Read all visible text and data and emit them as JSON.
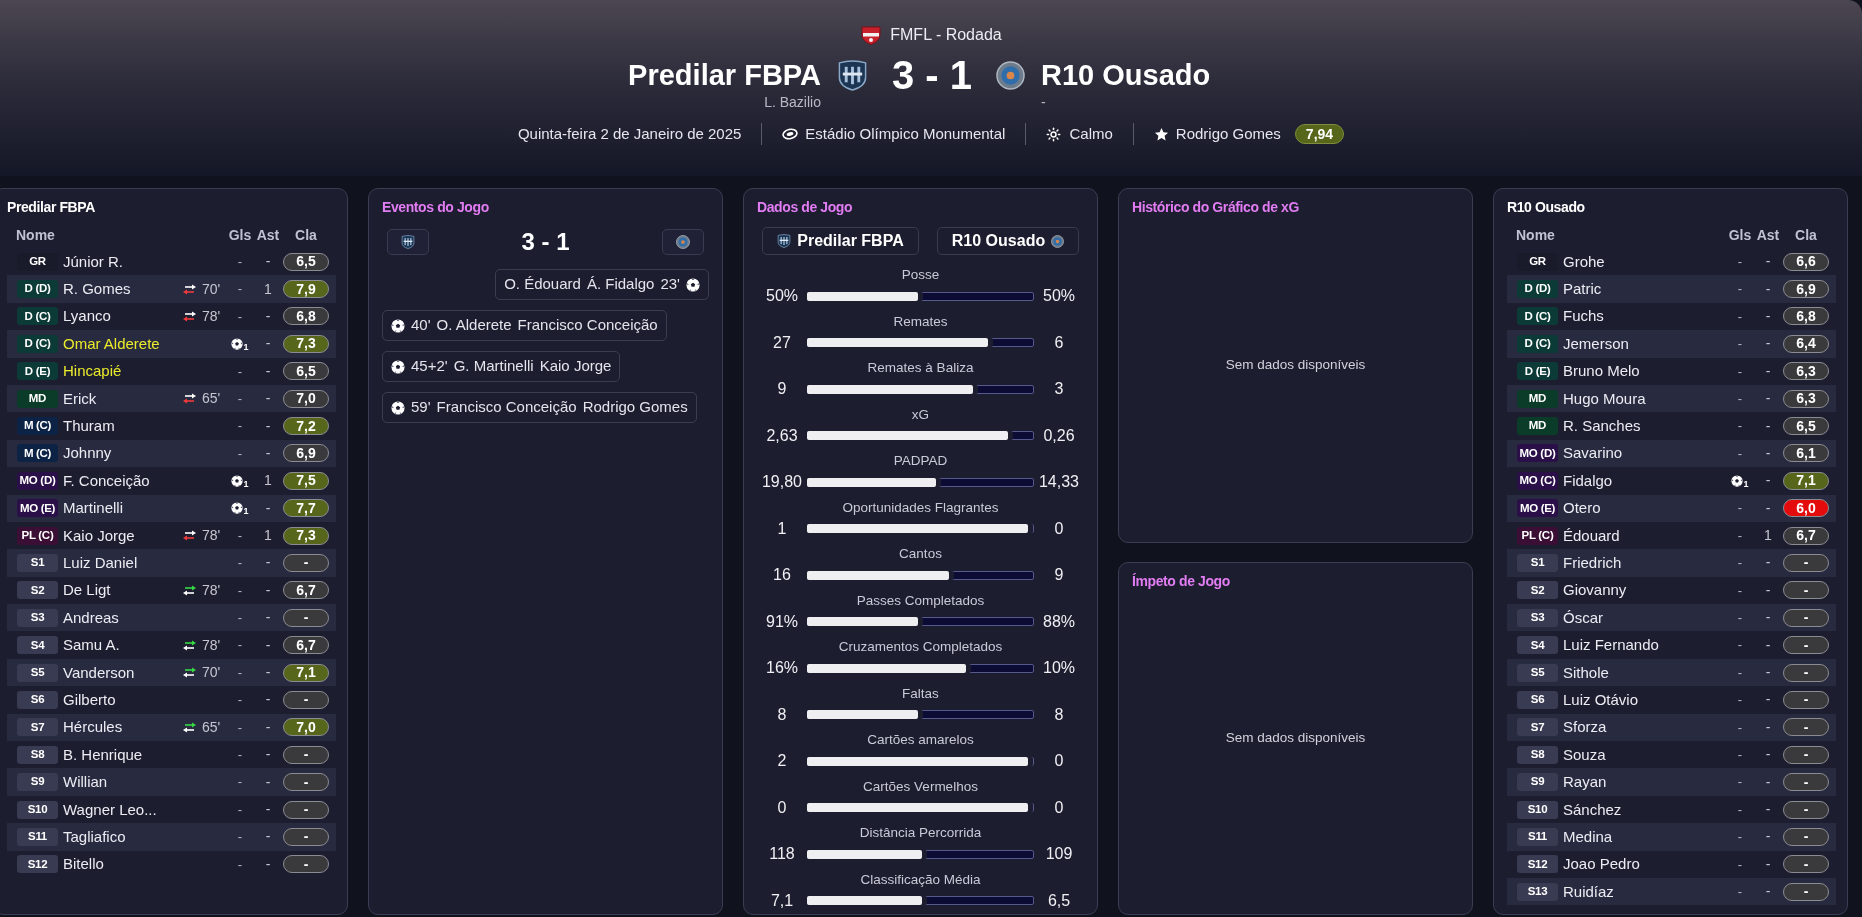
{
  "header": {
    "competition": "FMFL - Rodada",
    "home_team": "Predilar FBPA",
    "home_manager": "L. Bazilio",
    "score": "3 - 1",
    "away_team": "R10 Ousado",
    "away_manager": "-",
    "date": "Quinta-feira 2 de Janeiro de 2025",
    "stadium": "Estádio Olímpico Monumental",
    "weather": "Calmo",
    "player_of_match": "Rodrigo Gomes",
    "player_of_match_rating": "7,94"
  },
  "home_lineup": {
    "title": "Predilar FBPA",
    "columns": [
      "Nome",
      "Gls",
      "Ast",
      "Cla"
    ],
    "players": [
      {
        "position": {
          "text": "GR",
          "color": "#1a1b2a"
        },
        "name": "Júnior R.",
        "highlighted": false,
        "goals": "-",
        "scored": false,
        "assists": "-",
        "rating": {
          "text": "6,5",
          "color": "#3a3a3c"
        }
      },
      {
        "position": {
          "text": "D (D)",
          "color": "#0c3b37"
        },
        "name": "R. Gomes",
        "highlighted": false,
        "substitution": {
          "kind": "off",
          "minute": "70'"
        },
        "goals": "-",
        "scored": false,
        "assists": "1",
        "rating": {
          "text": "7,9",
          "color": "#56671b"
        }
      },
      {
        "position": {
          "text": "D (C)",
          "color": "#0c3b37"
        },
        "name": "Lyanco",
        "highlighted": false,
        "substitution": {
          "kind": "off",
          "minute": "78'"
        },
        "goals": "-",
        "scored": false,
        "assists": "-",
        "rating": {
          "text": "6,8",
          "color": "#3a3a3c"
        }
      },
      {
        "position": {
          "text": "D (C)",
          "color": "#0c3b37"
        },
        "name": "Omar Alderete",
        "highlighted": true,
        "goals": "1",
        "scored": true,
        "assists": "-",
        "rating": {
          "text": "7,3",
          "color": "#56671b"
        }
      },
      {
        "position": {
          "text": "D (E)",
          "color": "#0c3b37"
        },
        "name": "Hincapié",
        "highlighted": true,
        "goals": "-",
        "scored": false,
        "assists": "-",
        "rating": {
          "text": "6,5",
          "color": "#3a3a3c"
        }
      },
      {
        "position": {
          "text": "MD",
          "color": "#0b3b29"
        },
        "name": "Erick",
        "highlighted": false,
        "substitution": {
          "kind": "off",
          "minute": "65'"
        },
        "goals": "-",
        "scored": false,
        "assists": "-",
        "rating": {
          "text": "7,0",
          "color": "#3a3a3c"
        }
      },
      {
        "position": {
          "text": "M (C)",
          "color": "#0c2346"
        },
        "name": "Thuram",
        "highlighted": false,
        "goals": "-",
        "scored": false,
        "assists": "-",
        "rating": {
          "text": "7,2",
          "color": "#56671b"
        }
      },
      {
        "position": {
          "text": "M (C)",
          "color": "#0c2346"
        },
        "name": "Johnny",
        "highlighted": false,
        "goals": "-",
        "scored": false,
        "assists": "-",
        "rating": {
          "text": "6,9",
          "color": "#3a3a3c"
        }
      },
      {
        "position": {
          "text": "MO (D)",
          "color": "#2b0f48"
        },
        "name": "F. Conceição",
        "highlighted": false,
        "goals": "1",
        "scored": true,
        "assists": "1",
        "rating": {
          "text": "7,5",
          "color": "#56671b"
        }
      },
      {
        "position": {
          "text": "MO (E)",
          "color": "#2b0f48"
        },
        "name": "Martinelli",
        "highlighted": false,
        "goals": "1",
        "scored": true,
        "assists": "-",
        "rating": {
          "text": "7,7",
          "color": "#56671b"
        }
      },
      {
        "position": {
          "text": "PL (C)",
          "color": "#3b0f35"
        },
        "name": "Kaio Jorge",
        "highlighted": false,
        "substitution": {
          "kind": "off",
          "minute": "78'"
        },
        "goals": "-",
        "scored": false,
        "assists": "1",
        "rating": {
          "text": "7,3",
          "color": "#56671b"
        }
      },
      {
        "position": {
          "text": "S1",
          "color": "#393b52"
        },
        "name": "Luiz Daniel",
        "highlighted": false,
        "goals": "-",
        "scored": false,
        "assists": "-",
        "rating": {
          "text": "-",
          "color": "#3a3a3c"
        }
      },
      {
        "position": {
          "text": "S2",
          "color": "#393b52"
        },
        "name": "De Ligt",
        "highlighted": false,
        "substitution": {
          "kind": "on",
          "minute": "78'"
        },
        "goals": "-",
        "scored": false,
        "assists": "-",
        "rating": {
          "text": "6,7",
          "color": "#3a3a3c"
        }
      },
      {
        "position": {
          "text": "S3",
          "color": "#393b52"
        },
        "name": "Andreas",
        "highlighted": false,
        "goals": "-",
        "scored": false,
        "assists": "-",
        "rating": {
          "text": "-",
          "color": "#3a3a3c"
        }
      },
      {
        "position": {
          "text": "S4",
          "color": "#393b52"
        },
        "name": "Samu A.",
        "highlighted": false,
        "substitution": {
          "kind": "on",
          "minute": "78'"
        },
        "goals": "-",
        "scored": false,
        "assists": "-",
        "rating": {
          "text": "6,7",
          "color": "#3a3a3c"
        }
      },
      {
        "position": {
          "text": "S5",
          "color": "#393b52"
        },
        "name": "Vanderson",
        "highlighted": false,
        "substitution": {
          "kind": "on",
          "minute": "70'"
        },
        "goals": "-",
        "scored": false,
        "assists": "-",
        "rating": {
          "text": "7,1",
          "color": "#56671b"
        }
      },
      {
        "position": {
          "text": "S6",
          "color": "#393b52"
        },
        "name": "Gilberto",
        "highlighted": false,
        "goals": "-",
        "scored": false,
        "assists": "-",
        "rating": {
          "text": "-",
          "color": "#3a3a3c"
        }
      },
      {
        "position": {
          "text": "S7",
          "color": "#393b52"
        },
        "name": "Hércules",
        "highlighted": false,
        "substitution": {
          "kind": "on",
          "minute": "65'"
        },
        "goals": "-",
        "scored": false,
        "assists": "-",
        "rating": {
          "text": "7,0",
          "color": "#56671b"
        }
      },
      {
        "position": {
          "text": "S8",
          "color": "#393b52"
        },
        "name": "B. Henrique",
        "highlighted": false,
        "goals": "-",
        "scored": false,
        "assists": "-",
        "rating": {
          "text": "-",
          "color": "#3a3a3c"
        }
      },
      {
        "position": {
          "text": "S9",
          "color": "#393b52"
        },
        "name": "Willian",
        "highlighted": false,
        "goals": "-",
        "scored": false,
        "assists": "-",
        "rating": {
          "text": "-",
          "color": "#3a3a3c"
        }
      },
      {
        "position": {
          "text": "S10",
          "color": "#393b52"
        },
        "name": "Wagner Leo...",
        "highlighted": false,
        "goals": "-",
        "scored": false,
        "assists": "-",
        "rating": {
          "text": "-",
          "color": "#3a3a3c"
        }
      },
      {
        "position": {
          "text": "S11",
          "color": "#393b52"
        },
        "name": "Tagliafico",
        "highlighted": false,
        "goals": "-",
        "scored": false,
        "assists": "-",
        "rating": {
          "text": "-",
          "color": "#3a3a3c"
        }
      },
      {
        "position": {
          "text": "S12",
          "color": "#393b52"
        },
        "name": "Bitello",
        "highlighted": false,
        "goals": "-",
        "scored": false,
        "assists": "-",
        "rating": {
          "text": "-",
          "color": "#3a3a3c"
        }
      }
    ]
  },
  "events": {
    "title": "Eventos do Jogo",
    "score": "3 - 1",
    "items": [
      {
        "kind": "away",
        "minute": "23'",
        "scorer": "O. Édouard",
        "assist": "Á. Fidalgo"
      },
      {
        "kind": "home",
        "minute": "40'",
        "scorer": "O. Alderete",
        "assist": "Francisco Conceição"
      },
      {
        "kind": "home",
        "minute": "45+2'",
        "scorer": "G. Martinelli",
        "assist": "Kaio Jorge"
      },
      {
        "kind": "home",
        "minute": "59'",
        "scorer": "Francisco Conceição",
        "assist": "Rodrigo Gomes"
      }
    ]
  },
  "stats": {
    "title": "Dados de Jogo",
    "home_team": "Predilar FBPA",
    "away_team": "R10 Ousado",
    "rows": [
      {
        "label": "Posse",
        "home": "50%",
        "away": "50%",
        "level": 0.5
      },
      {
        "label": "Remates",
        "home": "27",
        "away": "6",
        "level": 0.82
      },
      {
        "label": "Remates à Baliza",
        "home": "9",
        "away": "3",
        "level": 0.75
      },
      {
        "label": "xG",
        "home": "2,63",
        "away": "0,26",
        "level": 0.91
      },
      {
        "label": "PADPAD",
        "home": "19,80",
        "away": "14,33",
        "level": 0.58
      },
      {
        "label": "Oportunidades Flagrantes",
        "home": "1",
        "away": "0",
        "level": 1
      },
      {
        "label": "Cantos",
        "home": "16",
        "away": "9",
        "level": 0.64
      },
      {
        "label": "Passes Completados",
        "home": "91%",
        "away": "88%",
        "level": 0.5
      },
      {
        "label": "Cruzamentos Completados",
        "home": "16%",
        "away": "10%",
        "level": 0.72
      },
      {
        "label": "Faltas",
        "home": "8",
        "away": "8",
        "level": 0.5
      },
      {
        "label": "Cartões amarelos",
        "home": "2",
        "away": "0",
        "level": 1
      },
      {
        "label": "Cartões Vermelhos",
        "home": "0",
        "away": "0",
        "level": 1
      },
      {
        "label": "Distância Percorrida",
        "home": "118",
        "away": "109",
        "level": 0.52
      },
      {
        "label": "Classificação Média",
        "home": "7,1",
        "away": "6,5",
        "level": 0.52
      }
    ]
  },
  "xg_history": {
    "title": "Histórico do Gráfico de xG",
    "empty_message": "Sem dados disponíveis"
  },
  "momentum": {
    "title": "Ímpeto de Jogo",
    "empty_message": "Sem dados disponíveis"
  },
  "away_lineup": {
    "title": "R10 Ousado",
    "columns": [
      "Nome",
      "Gls",
      "Ast",
      "Cla"
    ],
    "players": [
      {
        "position": {
          "text": "GR",
          "color": "#1a1b2a"
        },
        "name": "Grohe",
        "highlighted": false,
        "goals": "-",
        "scored": false,
        "assists": "-",
        "rating": {
          "text": "6,6",
          "color": "#3a3a3c"
        }
      },
      {
        "position": {
          "text": "D (D)",
          "color": "#0c3b37"
        },
        "name": "Patric",
        "highlighted": false,
        "goals": "-",
        "scored": false,
        "assists": "-",
        "rating": {
          "text": "6,9",
          "color": "#3a3a3c"
        }
      },
      {
        "position": {
          "text": "D (C)",
          "color": "#0c3b37"
        },
        "name": "Fuchs",
        "highlighted": false,
        "goals": "-",
        "scored": false,
        "assists": "-",
        "rating": {
          "text": "6,8",
          "color": "#3a3a3c"
        }
      },
      {
        "position": {
          "text": "D (C)",
          "color": "#0c3b37"
        },
        "name": "Jemerson",
        "highlighted": false,
        "goals": "-",
        "scored": false,
        "assists": "-",
        "rating": {
          "text": "6,4",
          "color": "#3a3a3c"
        }
      },
      {
        "position": {
          "text": "D (E)",
          "color": "#0c3b37"
        },
        "name": "Bruno Melo",
        "highlighted": false,
        "goals": "-",
        "scored": false,
        "assists": "-",
        "rating": {
          "text": "6,3",
          "color": "#3a3a3c"
        }
      },
      {
        "position": {
          "text": "MD",
          "color": "#0b3b29"
        },
        "name": "Hugo Moura",
        "highlighted": false,
        "goals": "-",
        "scored": false,
        "assists": "-",
        "rating": {
          "text": "6,3",
          "color": "#3a3a3c"
        }
      },
      {
        "position": {
          "text": "MD",
          "color": "#0b3b29"
        },
        "name": "R. Sanches",
        "highlighted": false,
        "goals": "-",
        "scored": false,
        "assists": "-",
        "rating": {
          "text": "6,5",
          "color": "#3a3a3c"
        }
      },
      {
        "position": {
          "text": "MO (D)",
          "color": "#2b0f48"
        },
        "name": "Savarino",
        "highlighted": false,
        "goals": "-",
        "scored": false,
        "assists": "-",
        "rating": {
          "text": "6,1",
          "color": "#3a3a3c"
        }
      },
      {
        "position": {
          "text": "MO (C)",
          "color": "#2b0f48"
        },
        "name": "Fidalgo",
        "highlighted": false,
        "goals": "1",
        "scored": true,
        "assists": "-",
        "rating": {
          "text": "7,1",
          "color": "#56671b"
        }
      },
      {
        "position": {
          "text": "MO (E)",
          "color": "#2b0f48"
        },
        "name": "Otero",
        "highlighted": false,
        "goals": "-",
        "scored": false,
        "assists": "-",
        "rating": {
          "text": "6,0",
          "color": "#e30b0b"
        }
      },
      {
        "position": {
          "text": "PL (C)",
          "color": "#3b0f35"
        },
        "name": "Édouard",
        "highlighted": false,
        "goals": "-",
        "scored": false,
        "assists": "1",
        "rating": {
          "text": "6,7",
          "color": "#3a3a3c"
        }
      },
      {
        "position": {
          "text": "S1",
          "color": "#393b52"
        },
        "name": "Friedrich",
        "highlighted": false,
        "goals": "-",
        "scored": false,
        "assists": "-",
        "rating": {
          "text": "-",
          "color": "#3a3a3c"
        }
      },
      {
        "position": {
          "text": "S2",
          "color": "#393b52"
        },
        "name": "Giovanny",
        "highlighted": false,
        "goals": "-",
        "scored": false,
        "assists": "-",
        "rating": {
          "text": "-",
          "color": "#3a3a3c"
        }
      },
      {
        "position": {
          "text": "S3",
          "color": "#393b52"
        },
        "name": "Óscar",
        "highlighted": false,
        "goals": "-",
        "scored": false,
        "assists": "-",
        "rating": {
          "text": "-",
          "color": "#3a3a3c"
        }
      },
      {
        "position": {
          "text": "S4",
          "color": "#393b52"
        },
        "name": "Luiz Fernando",
        "highlighted": false,
        "goals": "-",
        "scored": false,
        "assists": "-",
        "rating": {
          "text": "-",
          "color": "#3a3a3c"
        }
      },
      {
        "position": {
          "text": "S5",
          "color": "#393b52"
        },
        "name": "Sithole",
        "highlighted": false,
        "goals": "-",
        "scored": false,
        "assists": "-",
        "rating": {
          "text": "-",
          "color": "#3a3a3c"
        }
      },
      {
        "position": {
          "text": "S6",
          "color": "#393b52"
        },
        "name": "Luiz Otávio",
        "highlighted": false,
        "goals": "-",
        "scored": false,
        "assists": "-",
        "rating": {
          "text": "-",
          "color": "#3a3a3c"
        }
      },
      {
        "position": {
          "text": "S7",
          "color": "#393b52"
        },
        "name": "Sforza",
        "highlighted": false,
        "goals": "-",
        "scored": false,
        "assists": "-",
        "rating": {
          "text": "-",
          "color": "#3a3a3c"
        }
      },
      {
        "position": {
          "text": "S8",
          "color": "#393b52"
        },
        "name": "Souza",
        "highlighted": false,
        "goals": "-",
        "scored": false,
        "assists": "-",
        "rating": {
          "text": "-",
          "color": "#3a3a3c"
        }
      },
      {
        "position": {
          "text": "S9",
          "color": "#393b52"
        },
        "name": "Rayan",
        "highlighted": false,
        "goals": "-",
        "scored": false,
        "assists": "-",
        "rating": {
          "text": "-",
          "color": "#3a3a3c"
        }
      },
      {
        "position": {
          "text": "S10",
          "color": "#393b52"
        },
        "name": "Sánchez",
        "highlighted": false,
        "goals": "-",
        "scored": false,
        "assists": "-",
        "rating": {
          "text": "-",
          "color": "#3a3a3c"
        }
      },
      {
        "position": {
          "text": "S11",
          "color": "#393b52"
        },
        "name": "Medina",
        "highlighted": false,
        "goals": "-",
        "scored": false,
        "assists": "-",
        "rating": {
          "text": "-",
          "color": "#3a3a3c"
        }
      },
      {
        "position": {
          "text": "S12",
          "color": "#393b52"
        },
        "name": "Joao Pedro",
        "highlighted": false,
        "goals": "-",
        "scored": false,
        "assists": "-",
        "rating": {
          "text": "-",
          "color": "#3a3a3c"
        }
      },
      {
        "position": {
          "text": "S13",
          "color": "#393b52"
        },
        "name": "Ruidíaz",
        "highlighted": false,
        "goals": "-",
        "scored": false,
        "assists": "-",
        "rating": {
          "text": "-",
          "color": "#3a3a3c"
        }
      }
    ]
  }
}
